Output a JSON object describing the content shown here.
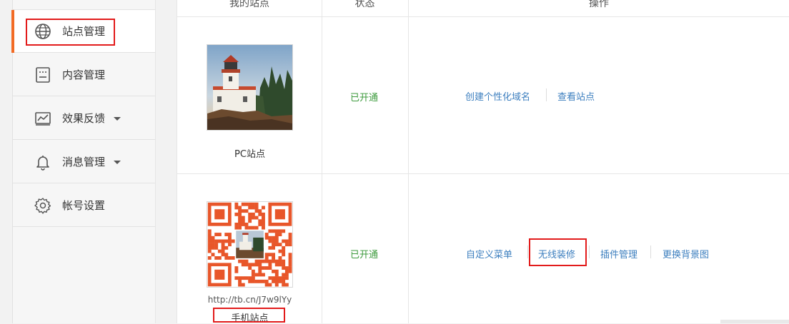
{
  "sidebar": {
    "items": [
      {
        "label": "站点管理",
        "icon": "globe-icon",
        "active": true
      },
      {
        "label": "内容管理",
        "icon": "document-icon",
        "active": false
      },
      {
        "label": "效果反馈",
        "icon": "chart-icon",
        "active": false,
        "dropdown": true
      },
      {
        "label": "消息管理",
        "icon": "bell-icon",
        "active": false,
        "dropdown": true
      },
      {
        "label": "帐号设置",
        "icon": "gear-icon",
        "active": false
      }
    ]
  },
  "table": {
    "headers": {
      "site": "我的站点",
      "status": "状态",
      "actions": "操作"
    },
    "rows": [
      {
        "site_caption": "PC站点",
        "status": "已开通",
        "actions": [
          "创建个性化域名",
          "查看站点"
        ]
      },
      {
        "site_url": "http://tb.cn/J7w9lYy",
        "site_caption": "手机站点",
        "status": "已开通",
        "actions": [
          "自定义菜单",
          "无线装修",
          "插件管理",
          "更换背景图"
        ]
      }
    ]
  },
  "colors": {
    "accent": "#f26b25",
    "highlight": "#e21b1b",
    "link": "#3d7fbf",
    "status_ok": "#3c9a3c"
  }
}
